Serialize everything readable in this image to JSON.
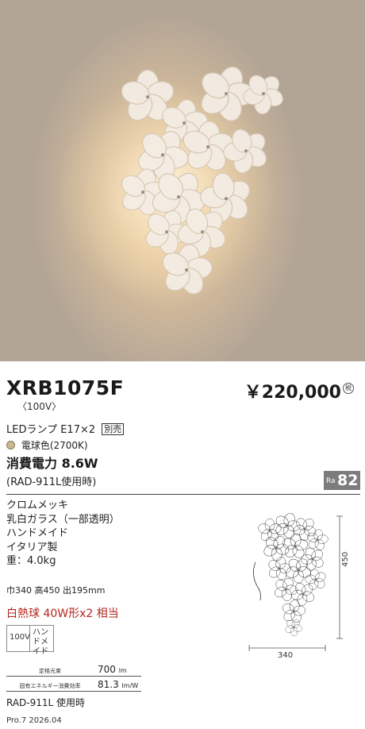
{
  "product": {
    "model": "XRB1075F",
    "voltage_note": "〈100V〉",
    "price": "￥220,000",
    "tax_mark": "税",
    "lamp": "LEDランプ E17×2",
    "sold_separately": "別売",
    "color": "電球色(2700K)",
    "color_swatch": "#c9b892",
    "power": "消費電力 8.6W",
    "rad_usage": "(RAD-911L使用時)",
    "ra_label": "Ra",
    "ra_value": "82"
  },
  "specs": [
    "クロムメッキ",
    "乳白ガラス（一部透明）",
    "ハンドメイド",
    "イタリア製",
    "重：4.0kg"
  ],
  "dimensions": "巾340 高450 出195mm",
  "equivalent": "白熱球 40W形x2 相当",
  "tags": {
    "voltage": "100V",
    "handmade": "ハンドメイド"
  },
  "efficiency": {
    "lumen_label": "定格光束",
    "lumen_value": "700",
    "lumen_unit": "lm",
    "eff_label": "固有エネルギー消費効率",
    "eff_value": "81.3",
    "eff_unit": "lm/W"
  },
  "rad_use": "RAD-911L 使用時",
  "footer": "Pro.7 2026.04",
  "drawing": {
    "height_label": "450",
    "width_label": "340"
  },
  "colors": {
    "accent_red": "#b3261e",
    "badge_gray": "#7c7c7c"
  }
}
